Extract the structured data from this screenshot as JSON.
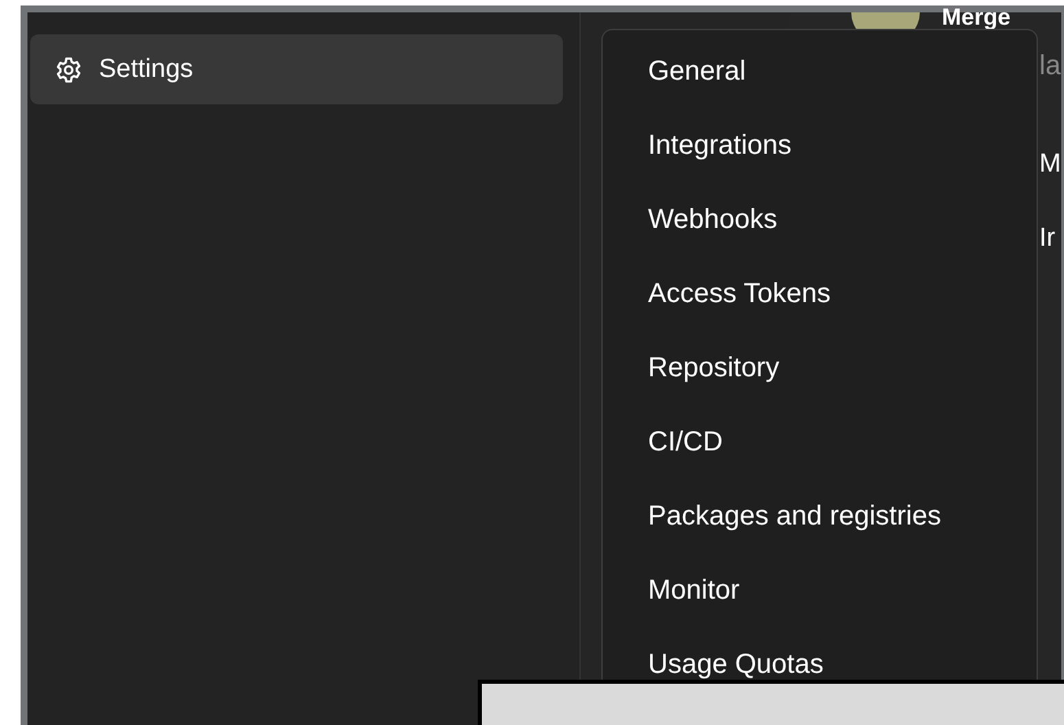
{
  "sidebar": {
    "items": [
      {
        "label": "Settings",
        "selected": true
      }
    ]
  },
  "background_content": {
    "title": "Merge",
    "line_2": "la",
    "row_1": "M",
    "row_2": "Ir"
  },
  "settings_menu": {
    "items": [
      {
        "label": "General"
      },
      {
        "label": "Integrations"
      },
      {
        "label": "Webhooks"
      },
      {
        "label": "Access Tokens"
      },
      {
        "label": "Repository"
      },
      {
        "label": "CI/CD"
      },
      {
        "label": "Packages and registries"
      },
      {
        "label": "Monitor"
      },
      {
        "label": "Usage Quotas"
      }
    ]
  }
}
